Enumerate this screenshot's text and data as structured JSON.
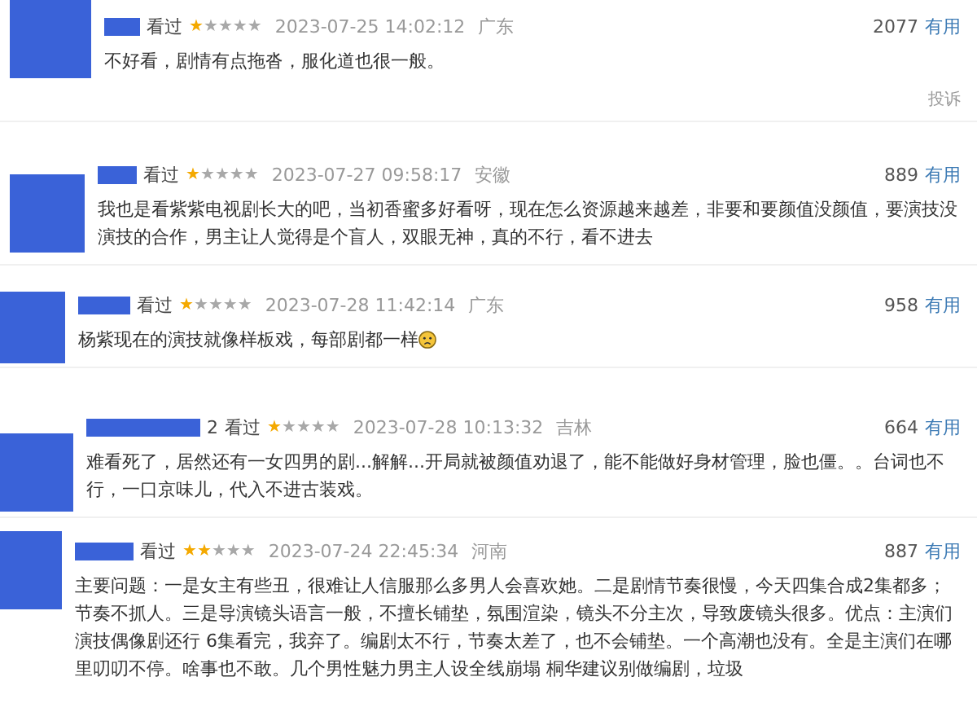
{
  "reviews": [
    {
      "status": "看过",
      "stars": 1,
      "time": "2023-07-25 14:02:12",
      "location": "广东",
      "votes": "2077",
      "useful": "有用",
      "text": "不好看，剧情有点拖沓，服化道也很一般。",
      "report": "投诉",
      "emoji": false
    },
    {
      "status": "看过",
      "stars": 1,
      "time": "2023-07-27 09:58:17",
      "location": "安徽",
      "votes": "889",
      "useful": "有用",
      "text": "我也是看紫紫电视剧长大的吧，当初香蜜多好看呀，现在怎么资源越来越差，非要和要颜值没颜值，要演技没演技的合作，男主让人觉得是个盲人，双眼无神，真的不行，看不进去",
      "emoji": false
    },
    {
      "status": "看过",
      "stars": 1,
      "time": "2023-07-28 11:42:14",
      "location": "广东",
      "votes": "958",
      "useful": "有用",
      "text": "杨紫现在的演技就像样板戏，每部剧都一样",
      "emoji": true
    },
    {
      "name_suffix": "2",
      "status": "看过",
      "stars": 1,
      "time": "2023-07-28 10:13:32",
      "location": "吉林",
      "votes": "664",
      "useful": "有用",
      "text": "难看死了，居然还有一女四男的剧...解解...开局就被颜值劝退了，能不能做好身材管理，脸也僵。。台词也不行，一口京味儿，代入不进古装戏。",
      "emoji": false
    },
    {
      "status": "看过",
      "stars": 2,
      "time": "2023-07-24 22:45:34",
      "location": "河南",
      "votes": "887",
      "useful": "有用",
      "text": "主要问题：一是女主有些丑，很难让人信服那么多男人会喜欢她。二是剧情节奏很慢，今天四集合成2集都多；节奏不抓人。三是导演镜头语言一般，不擅长铺垫，氛围渲染，镜头不分主次，导致废镜头很多。优点：主演们演技偶像剧还行 6集看完，我弃了。编剧太不行，节奏太差了，也不会铺垫。一个高潮也没有。全是主演们在哪里叨叨不停。啥事也不敢。几个男性魅力男主人设全线崩塌 桐华建议别做编剧，垃圾",
      "emoji": false
    }
  ]
}
